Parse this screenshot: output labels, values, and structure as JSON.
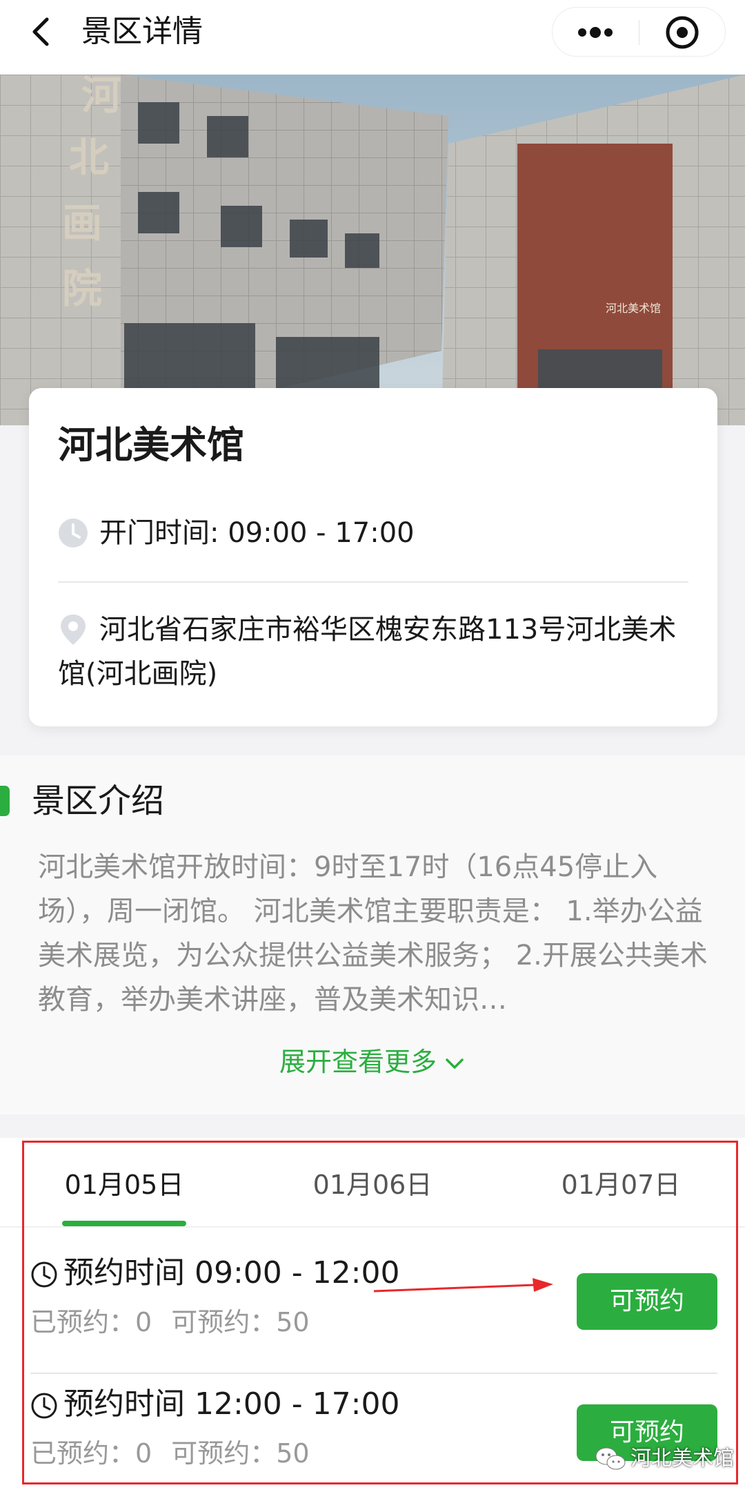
{
  "navbar": {
    "title": "景区详情",
    "back_icon": "chevron-left-icon",
    "more_icon": "more-dots-icon",
    "close_icon": "target-circle-icon"
  },
  "hero": {
    "photo": "museum-building-photo"
  },
  "venue": {
    "name": "河北美术馆",
    "hours": "开门时间: 09:00 - 17:00",
    "address": "河北省石家庄市裕华区槐安东路113号河北美术馆(河北画院)"
  },
  "intro": {
    "title": "景区介绍",
    "text": "河北美术馆开放时间：9时至17时（16点45停止入场），周一闭馆。 河北美术馆主要职责是： 1.举办公益美术展览，为公众提供公益美术服务； 2.开展公共美术教育，举办美术讲座，普及美术知识…",
    "expand": "展开查看更多"
  },
  "booking": {
    "dates": [
      "01月05日",
      "01月06日",
      "01月07日"
    ],
    "active_index": 0,
    "slots": [
      {
        "time": "预约时间 09:00 - 12:00",
        "booked": "已预约：0",
        "available": "可预约：50",
        "button": "可预约"
      },
      {
        "time": "预约时间 12:00 - 17:00",
        "booked": "已预约：0",
        "available": "可预约：50",
        "button": "可预约"
      }
    ]
  },
  "watermark": {
    "text": "河北美术馆"
  },
  "colors": {
    "accent": "#2bae3f",
    "annotation": "#e8282b",
    "muted_text": "#8d8d8d"
  }
}
